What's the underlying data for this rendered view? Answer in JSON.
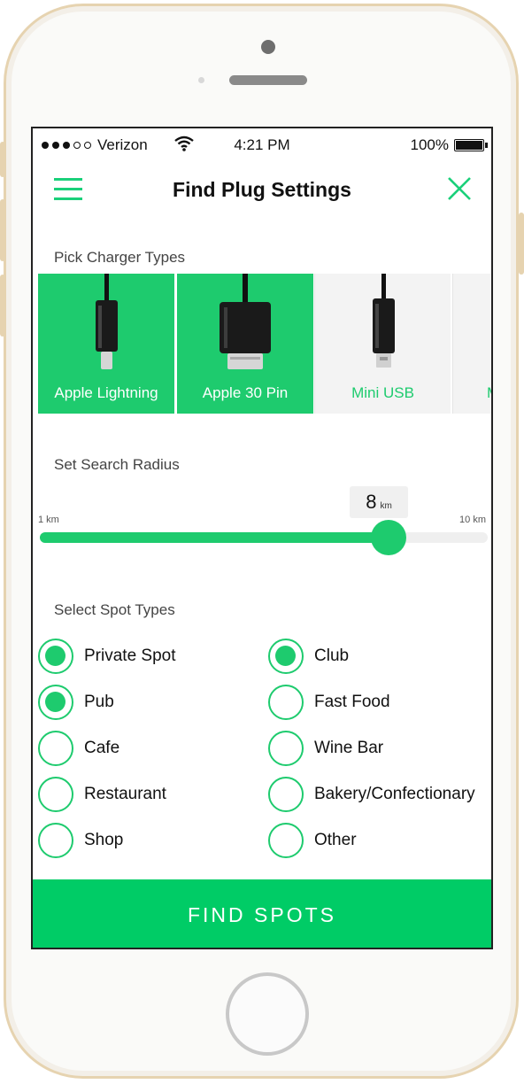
{
  "status": {
    "carrier": "Verizon",
    "time": "4:21 PM",
    "battery": "100%"
  },
  "nav": {
    "title": "Find Plug Settings"
  },
  "charger_section": {
    "label": "Pick Charger Types",
    "items": [
      {
        "label": "Apple Lightning",
        "selected": true
      },
      {
        "label": "Apple 30 Pin",
        "selected": true
      },
      {
        "label": "Mini USB",
        "selected": false
      },
      {
        "label": "M",
        "selected": false
      }
    ]
  },
  "radius_section": {
    "label": "Set Search Radius",
    "value": "8",
    "unit": "km",
    "min_label": "1 km",
    "max_label": "10 km",
    "min": 1,
    "max": 10,
    "current": 8
  },
  "spot_section": {
    "label": "Select Spot Types",
    "items": [
      {
        "label": "Private Spot",
        "checked": true
      },
      {
        "label": "Club",
        "checked": true
      },
      {
        "label": "Pub",
        "checked": true
      },
      {
        "label": "Fast Food",
        "checked": false
      },
      {
        "label": "Cafe",
        "checked": false
      },
      {
        "label": "Wine Bar",
        "checked": false
      },
      {
        "label": "Restaurant",
        "checked": false
      },
      {
        "label": "Bakery/Confectionary",
        "checked": false
      },
      {
        "label": "Shop",
        "checked": false
      },
      {
        "label": "Other",
        "checked": false
      }
    ]
  },
  "action": {
    "label": "FIND SPOTS"
  },
  "colors": {
    "accent": "#1ecb6e",
    "button": "#00cc66",
    "frame": "#e6d3b0"
  },
  "icons": [
    "signal-dots-icon",
    "wifi-icon",
    "battery-icon",
    "hamburger-menu-icon",
    "close-icon",
    "lightning-cable-icon",
    "30-pin-cable-icon",
    "mini-usb-cable-icon"
  ]
}
